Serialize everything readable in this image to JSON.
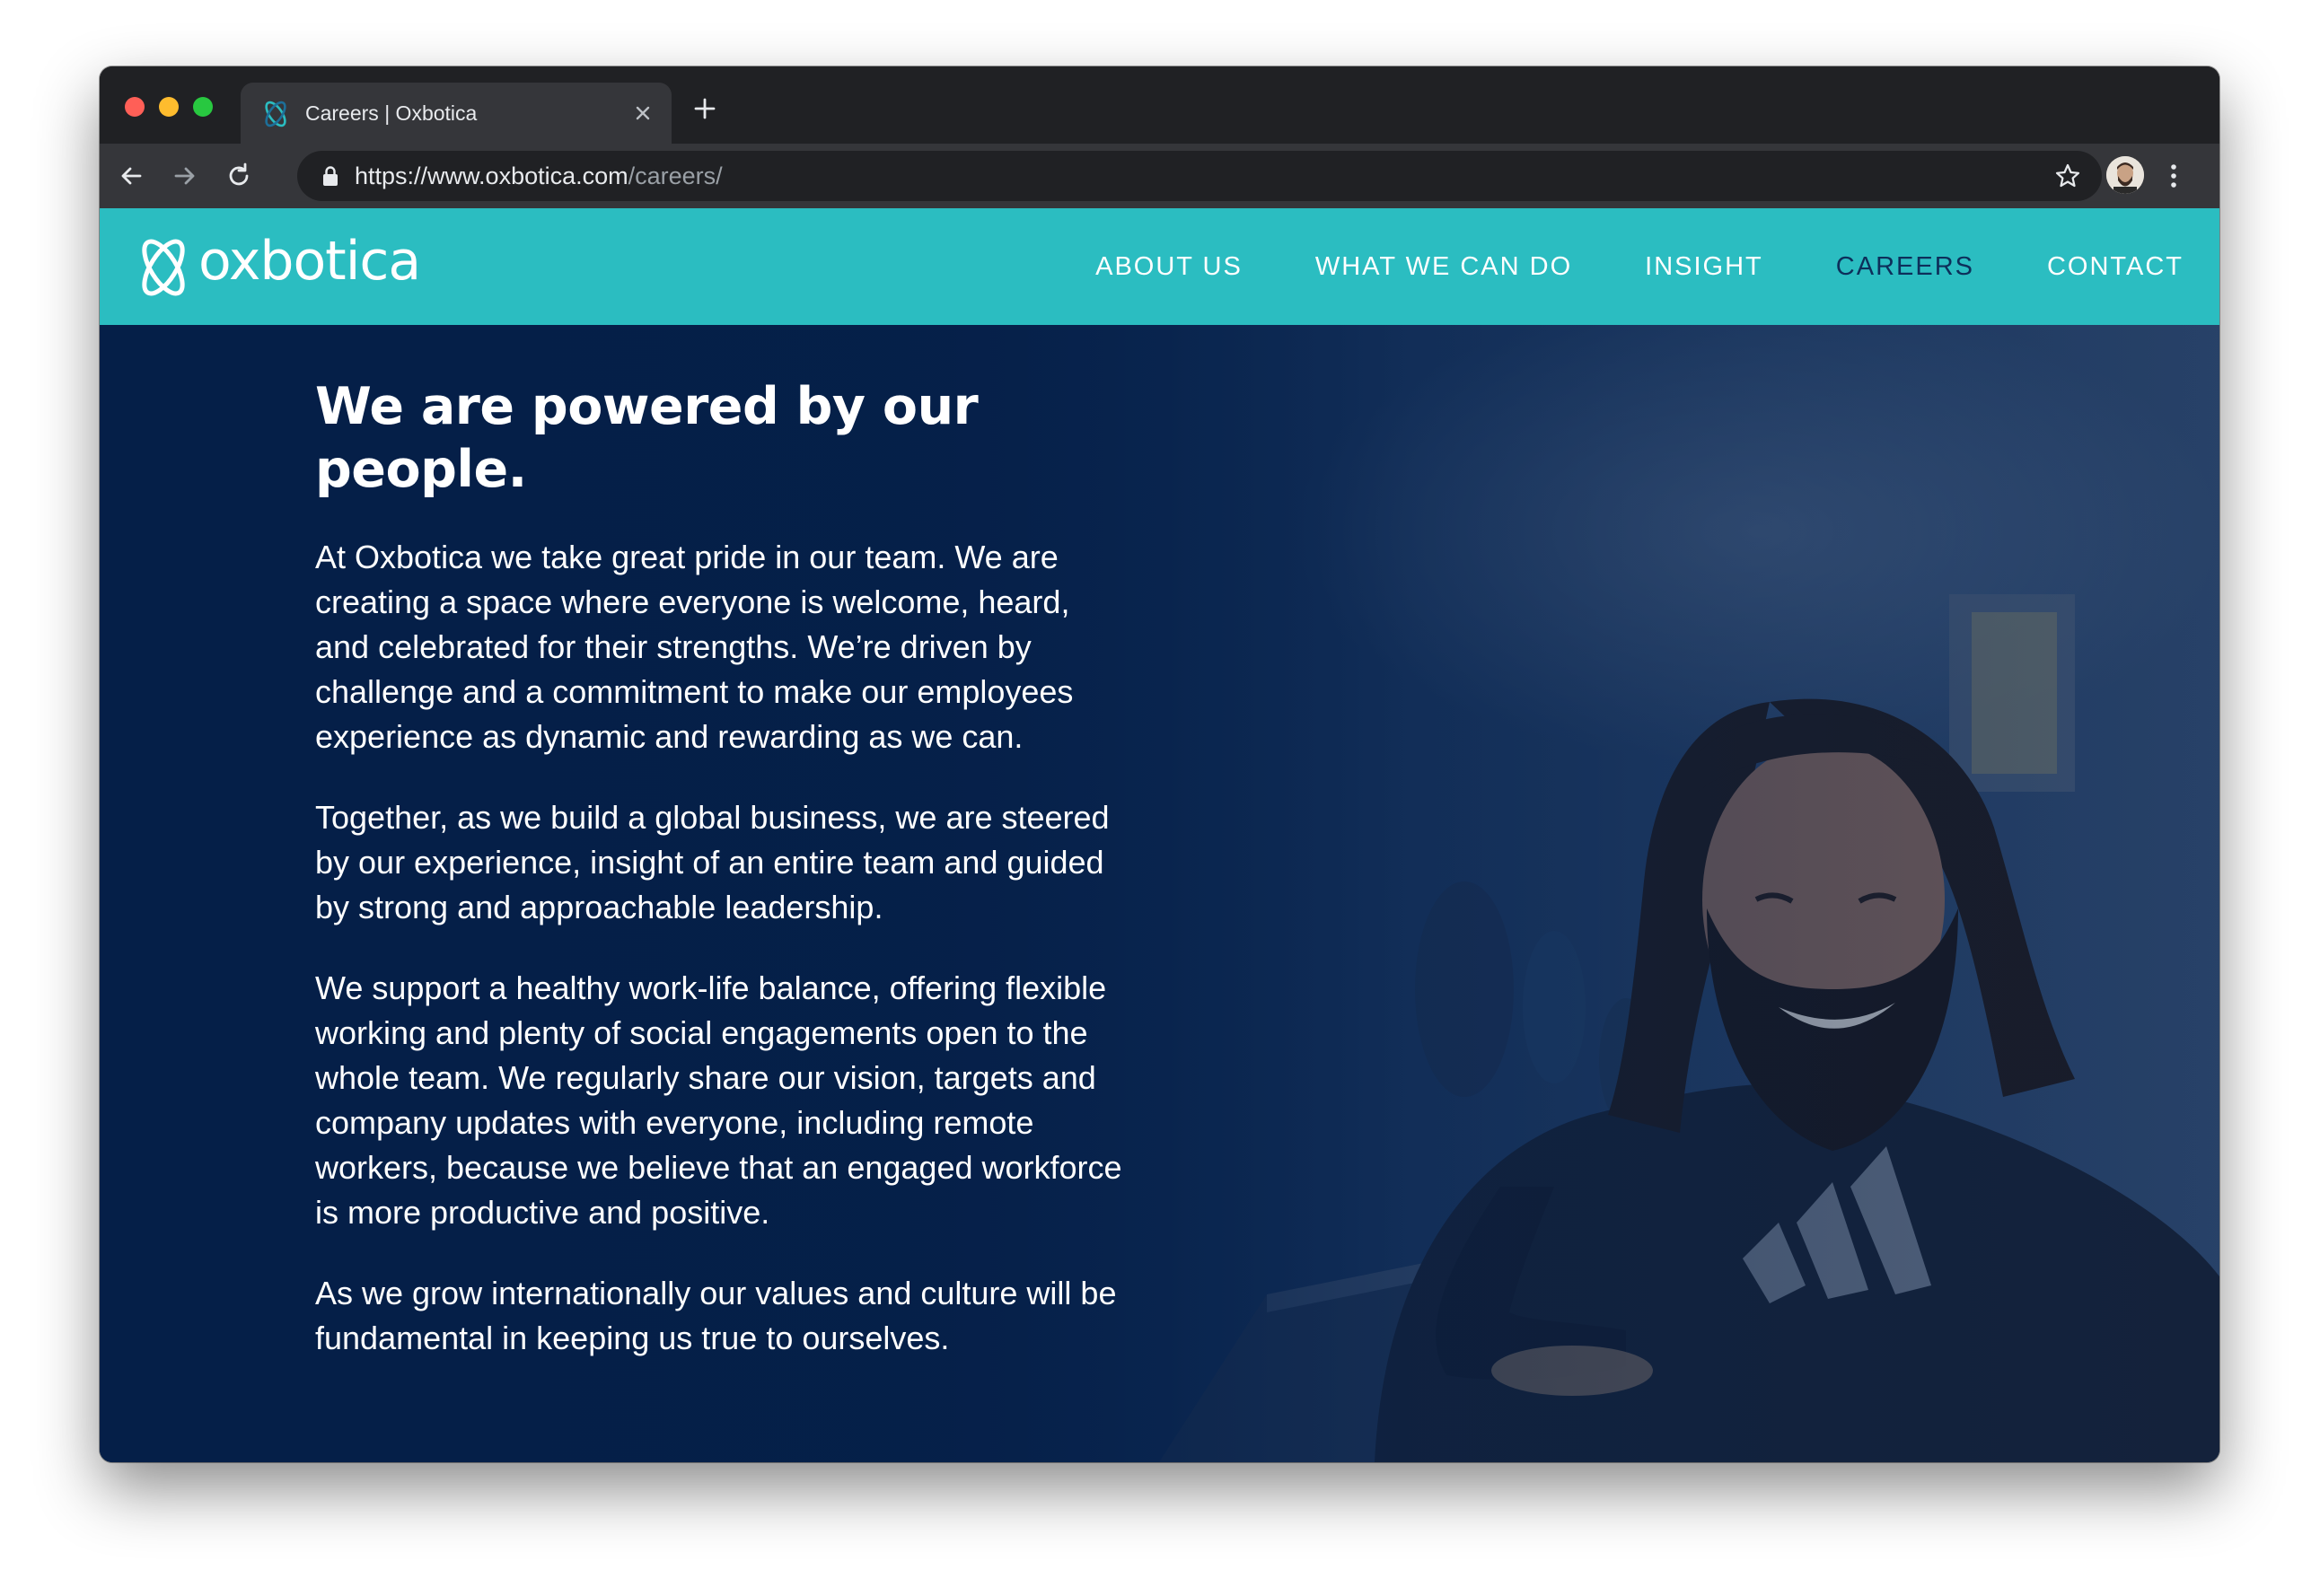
{
  "browser": {
    "tab_title": "Careers | Oxbotica",
    "url_host": "https://www.oxbotica.com",
    "url_path": "/careers/"
  },
  "site": {
    "logo_text": "oxbotica",
    "nav": [
      {
        "label": "ABOUT US",
        "active": false
      },
      {
        "label": "WHAT WE CAN DO",
        "active": false
      },
      {
        "label": "INSIGHT",
        "active": false
      },
      {
        "label": "CAREERS",
        "active": true
      },
      {
        "label": "CONTACT",
        "active": false
      }
    ]
  },
  "hero": {
    "headline": "We are powered by our people.",
    "paragraphs": [
      "At Oxbotica we take great pride in our team. We are creating a space where everyone is welcome, heard, and celebrated for their strengths. We’re driven by challenge and a commitment to make our employees experience as dynamic and rewarding as we can.",
      "Together, as we build a global business, we are steered by our experience, insight of an entire team and guided by strong and approachable leadership.",
      "We support a healthy work-life balance, offering flexible working and plenty of social engagements open to the whole team. We regularly share our vision, targets and company updates with everyone, including remote workers, because we believe that an engaged workforce is more productive and positive.",
      "As we grow internationally our values and culture will be fundamental in keeping us true to ourselves."
    ]
  },
  "colors": {
    "header_teal": "#2bbdc1",
    "nav_active": "#0d2f5a",
    "hero_navy": "#082551"
  }
}
